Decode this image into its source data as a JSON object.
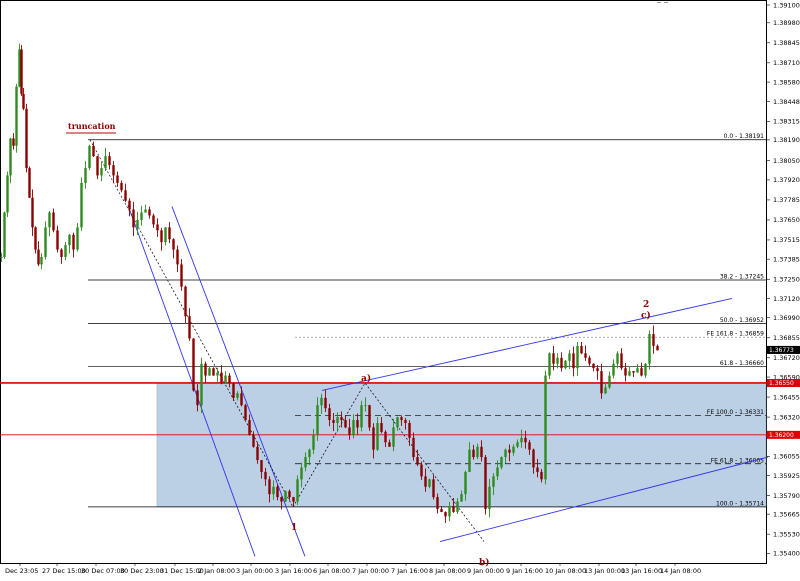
{
  "chart_data": {
    "type": "candlestick",
    "instrument": "EURUSD",
    "ylim": [
      1.35403,
      1.391
    ],
    "price_ticks": [
      "1.39100",
      "1.38980",
      "1.38845",
      "1.38710",
      "1.38580",
      "1.38448",
      "1.38315",
      "1.38190",
      "1.38050",
      "1.37920",
      "1.37785",
      "1.37650",
      "1.37515",
      "1.37385",
      "1.37250",
      "1.37120",
      "1.36990",
      "1.36855",
      "1.36720",
      "1.36590",
      "1.36455",
      "1.36320",
      "1.36190",
      "1.36055",
      "1.35925",
      "1.35790",
      "1.35665",
      "1.35530",
      "1.35400"
    ],
    "date_labels": [
      "Dec 23:05",
      "27 Dec 15:00",
      "30 Dec 07:00",
      "30 Dec 23:00",
      "31 Dec 15:00",
      "2 Jan 08:00",
      "3 Jan 00:00",
      "3 Jan 16:00",
      "6 Jan 08:00",
      "7 Jan 00:00",
      "7 Jan 16:00",
      "8 Jan 08:00",
      "9 Jan 00:00",
      "9 Jan 16:00",
      "10 Jan 08:00",
      "13 Jan 00:00",
      "13 Jan 16:00",
      "14 Jan 08:00"
    ],
    "current_price": "1.36773",
    "tagged_levels": [
      {
        "price": 1.3655,
        "text": "1.36550",
        "color": "#e00000"
      },
      {
        "price": 1.362,
        "text": "1.36200",
        "color": "#e00000"
      }
    ],
    "levels": [
      {
        "price": 1.38191,
        "label": "0.0 - 1.38191",
        "style": "solid"
      },
      {
        "price": 1.37245,
        "label": "38.2 - 1.37245",
        "style": "solid"
      },
      {
        "price": 1.36952,
        "label": "50.0 - 1.36952",
        "style": "solid"
      },
      {
        "price": 1.36859,
        "label": "FE 161.8 - 1.36859",
        "style": "dotted"
      },
      {
        "price": 1.3666,
        "label": "61.8 - 1.36660",
        "style": "solid"
      },
      {
        "price": 1.36331,
        "label": "FE 100.0 - 1.36331",
        "style": "dashed"
      },
      {
        "price": 1.36005,
        "label": "FE 61.8 - 1.36005",
        "style": "dashed"
      },
      {
        "price": 1.35714,
        "label": "100.0 - 1.35714",
        "style": "solid"
      }
    ],
    "annotations": [
      {
        "text": "truncation",
        "kind": "annot"
      },
      {
        "text": "a)",
        "kind": "wave"
      },
      {
        "text": "1",
        "kind": "wave"
      },
      {
        "text": "b)",
        "kind": "wave"
      },
      {
        "text": "2",
        "kind": "wave"
      },
      {
        "text": "c)",
        "kind": "wave"
      }
    ],
    "price_path": [
      [
        0,
        1.374
      ],
      [
        3,
        1.377
      ],
      [
        6,
        1.3795
      ],
      [
        9,
        1.382
      ],
      [
        12,
        1.3815
      ],
      [
        15,
        1.3855
      ],
      [
        18,
        1.388
      ],
      [
        20,
        1.385
      ],
      [
        22,
        1.384
      ],
      [
        25,
        1.38
      ],
      [
        28,
        1.378
      ],
      [
        31,
        1.376
      ],
      [
        34,
        1.3745
      ],
      [
        37,
        1.3735
      ],
      [
        40,
        1.374
      ],
      [
        44,
        1.376
      ],
      [
        48,
        1.377
      ],
      [
        52,
        1.3758
      ],
      [
        56,
        1.3745
      ],
      [
        60,
        1.374
      ],
      [
        64,
        1.3748
      ],
      [
        68,
        1.3755
      ],
      [
        72,
        1.3745
      ],
      [
        76,
        1.376
      ],
      [
        80,
        1.379
      ],
      [
        84,
        1.38
      ],
      [
        88,
        1.3815
      ],
      [
        92,
        1.3808
      ],
      [
        96,
        1.3795
      ],
      [
        100,
        1.38
      ],
      [
        104,
        1.3808
      ],
      [
        108,
        1.3802
      ],
      [
        112,
        1.3795
      ],
      [
        116,
        1.379
      ],
      [
        120,
        1.3785
      ],
      [
        124,
        1.3778
      ],
      [
        128,
        1.3772
      ],
      [
        132,
        1.376
      ],
      [
        136,
        1.3765
      ],
      [
        140,
        1.377
      ],
      [
        144,
        1.3772
      ],
      [
        148,
        1.3768
      ],
      [
        152,
        1.3762
      ],
      [
        156,
        1.3758
      ],
      [
        160,
        1.375
      ],
      [
        164,
        1.376
      ],
      [
        168,
        1.3752
      ],
      [
        172,
        1.3745
      ],
      [
        176,
        1.3735
      ],
      [
        180,
        1.372
      ],
      [
        184,
        1.37
      ],
      [
        188,
        1.3685
      ],
      [
        192,
        1.365
      ],
      [
        196,
        1.364
      ],
      [
        200,
        1.3668
      ],
      [
        204,
        1.366
      ],
      [
        208,
        1.3665
      ],
      [
        212,
        1.366
      ],
      [
        216,
        1.3662
      ],
      [
        220,
        1.3655
      ],
      [
        224,
        1.366
      ],
      [
        228,
        1.3655
      ],
      [
        232,
        1.3645
      ],
      [
        236,
        1.3648
      ],
      [
        240,
        1.364
      ],
      [
        244,
        1.363
      ],
      [
        248,
        1.362
      ],
      [
        252,
        1.3612
      ],
      [
        256,
        1.3603
      ],
      [
        260,
        1.3595
      ],
      [
        264,
        1.359
      ],
      [
        268,
        1.358
      ],
      [
        272,
        1.3585
      ],
      [
        276,
        1.3578
      ],
      [
        280,
        1.3575
      ],
      [
        284,
        1.3582
      ],
      [
        288,
        1.3578
      ],
      [
        292,
        1.3575
      ],
      [
        296,
        1.359
      ],
      [
        300,
        1.3598
      ],
      [
        304,
        1.3605
      ],
      [
        308,
        1.361
      ],
      [
        312,
        1.362
      ],
      [
        316,
        1.364
      ],
      [
        320,
        1.3645
      ],
      [
        324,
        1.3638
      ],
      [
        328,
        1.363
      ],
      [
        332,
        1.3628
      ],
      [
        336,
        1.3632
      ],
      [
        340,
        1.363
      ],
      [
        344,
        1.3625
      ],
      [
        348,
        1.362
      ],
      [
        352,
        1.363
      ],
      [
        356,
        1.3625
      ],
      [
        360,
        1.364
      ],
      [
        364,
        1.364
      ],
      [
        368,
        1.3625
      ],
      [
        372,
        1.361
      ],
      [
        376,
        1.3628
      ],
      [
        380,
        1.3622
      ],
      [
        384,
        1.3615
      ],
      [
        388,
        1.3612
      ],
      [
        392,
        1.3625
      ],
      [
        396,
        1.3632
      ],
      [
        400,
        1.363
      ],
      [
        404,
        1.3628
      ],
      [
        408,
        1.3618
      ],
      [
        412,
        1.3605
      ],
      [
        416,
        1.36
      ],
      [
        420,
        1.3592
      ],
      [
        424,
        1.3585
      ],
      [
        428,
        1.359
      ],
      [
        432,
        1.3578
      ],
      [
        436,
        1.357
      ],
      [
        440,
        1.3568
      ],
      [
        444,
        1.3565
      ],
      [
        448,
        1.3572
      ],
      [
        452,
        1.3568
      ],
      [
        456,
        1.3575
      ],
      [
        460,
        1.358
      ],
      [
        464,
        1.3595
      ],
      [
        468,
        1.361
      ],
      [
        472,
        1.3605
      ],
      [
        476,
        1.3612
      ],
      [
        480,
        1.3605
      ],
      [
        484,
        1.357
      ],
      [
        488,
        1.3585
      ],
      [
        492,
        1.3592
      ],
      [
        496,
        1.3598
      ],
      [
        500,
        1.3605
      ],
      [
        504,
        1.361
      ],
      [
        508,
        1.3608
      ],
      [
        512,
        1.3612
      ],
      [
        516,
        1.3615
      ],
      [
        520,
        1.3618
      ],
      [
        524,
        1.3615
      ],
      [
        528,
        1.361
      ],
      [
        532,
        1.3598
      ],
      [
        536,
        1.3595
      ],
      [
        540,
        1.359
      ],
      [
        544,
        1.366
      ],
      [
        548,
        1.3675
      ],
      [
        552,
        1.3668
      ],
      [
        556,
        1.3672
      ],
      [
        560,
        1.3665
      ],
      [
        564,
        1.367
      ],
      [
        568,
        1.3675
      ],
      [
        572,
        1.3665
      ],
      [
        576,
        1.368
      ],
      [
        580,
        1.3675
      ],
      [
        584,
        1.3672
      ],
      [
        588,
        1.3668
      ],
      [
        592,
        1.3665
      ],
      [
        596,
        1.3663
      ],
      [
        600,
        1.3648
      ],
      [
        604,
        1.3652
      ],
      [
        608,
        1.366
      ],
      [
        612,
        1.3668
      ],
      [
        616,
        1.3675
      ],
      [
        620,
        1.3665
      ],
      [
        624,
        1.366
      ],
      [
        628,
        1.3663
      ],
      [
        632,
        1.3662
      ],
      [
        636,
        1.3665
      ],
      [
        640,
        1.366
      ],
      [
        644,
        1.3668
      ],
      [
        648,
        1.3688
      ],
      [
        652,
        1.368
      ],
      [
        656,
        1.3677
      ]
    ]
  }
}
